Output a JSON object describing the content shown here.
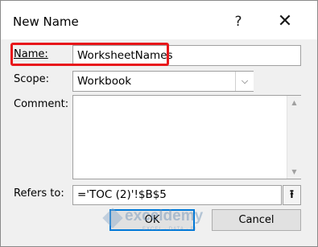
{
  "window": {
    "title": "New Name",
    "help_label": "?",
    "close_label": "✕"
  },
  "form": {
    "name_label": "Name:",
    "name_value": "WorksheetNames",
    "scope_label": "Scope:",
    "scope_value": "Workbook",
    "scope_arrow": "⌵",
    "comment_label": "Comment:",
    "comment_value": "",
    "refers_label": "Refers to:",
    "refers_value": "='TOC (2)'!$B$5",
    "collapse_icon": "⭱"
  },
  "buttons": {
    "ok_label": "OK",
    "cancel_label": "Cancel"
  },
  "watermark": {
    "brand": "exceldemy",
    "tagline": "EXCEL · DATA · BI"
  },
  "colors": {
    "highlight": "#e8171b",
    "ok_border": "#0078d7"
  }
}
